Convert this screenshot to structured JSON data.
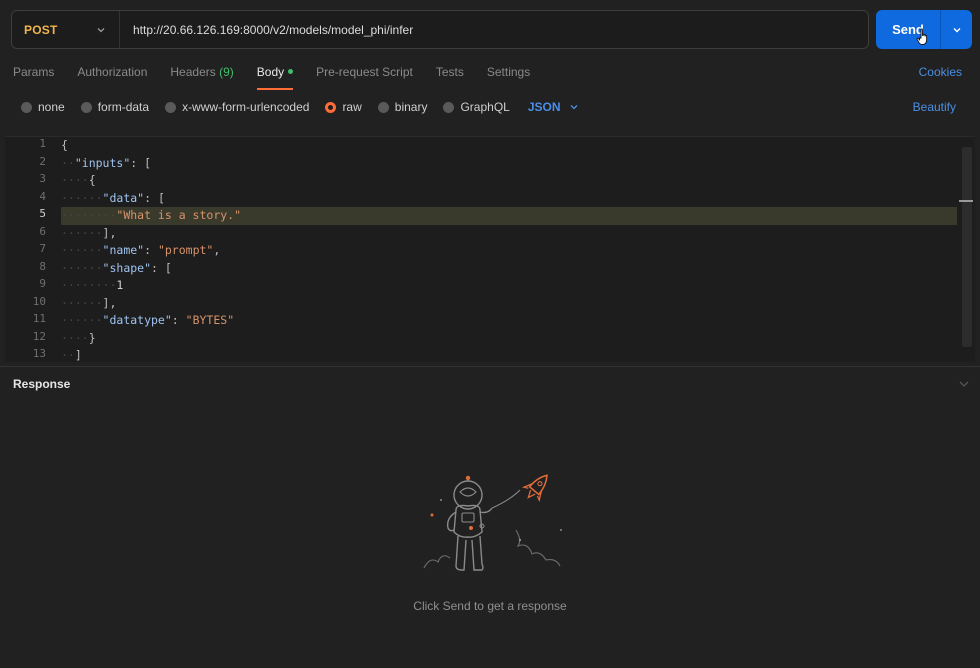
{
  "request": {
    "method": "POST",
    "url": "http://20.66.126.169:8000/v2/models/model_phi/infer",
    "send_label": "Send"
  },
  "tabs": [
    {
      "label": "Params"
    },
    {
      "label": "Authorization"
    },
    {
      "label": "Headers",
      "count": "(9)"
    },
    {
      "label": "Body"
    },
    {
      "label": "Pre-request Script"
    },
    {
      "label": "Tests"
    },
    {
      "label": "Settings"
    }
  ],
  "active_tab": "Body",
  "cookies_label": "Cookies",
  "body_types": [
    "none",
    "form-data",
    "x-www-form-urlencoded",
    "raw",
    "binary",
    "GraphQL"
  ],
  "selected_body_type": "raw",
  "format": "JSON",
  "beautify_label": "Beautify",
  "editor": {
    "line_numbers": [
      "1",
      "2",
      "3",
      "4",
      "5",
      "6",
      "7",
      "8",
      "9",
      "10",
      "11",
      "12",
      "13"
    ],
    "current_line": 5,
    "code": {
      "l1_brace": "{",
      "l2_key": "\"inputs\"",
      "l2_rest": ": [",
      "l3": "{",
      "l4_key": "\"data\"",
      "l4_rest": ": [",
      "l5_str": "\"What is a story.\"",
      "l6": "],",
      "l7_key": "\"name\"",
      "l7_colon": ": ",
      "l7_str": "\"prompt\"",
      "l7_comma": ",",
      "l8_key": "\"shape\"",
      "l8_rest": ": [",
      "l9_num": "1",
      "l10": "],",
      "l11_key": "\"datatype\"",
      "l11_colon": ": ",
      "l11_str": "\"BYTES\"",
      "l12": "}",
      "l13": "]"
    }
  },
  "response": {
    "title": "Response",
    "empty_message": "Click Send to get a response"
  },
  "colors": {
    "accent": "#ff6c37",
    "send": "#0f6ae0",
    "link": "#4a8fe6",
    "method": "#f0b64a",
    "success": "#3fbf6b"
  }
}
